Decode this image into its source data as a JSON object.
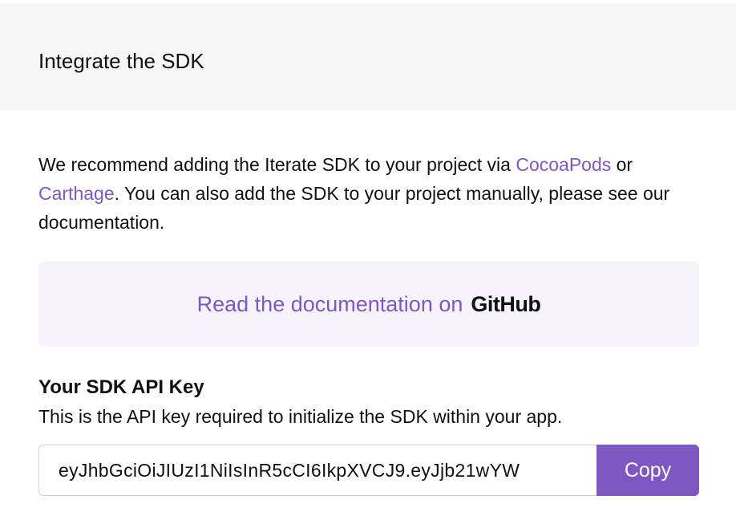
{
  "header": {
    "title": "Integrate the SDK"
  },
  "intro": {
    "text_before": "We recommend adding the Iterate SDK to your project via ",
    "cocoapods_link": "CocoaPods",
    "text_or": " or ",
    "carthage_link": "Carthage",
    "text_after": ". You can also add the SDK to your project manually, please see our documentation."
  },
  "docs": {
    "label": "Read the documentation on",
    "brand": "GitHub"
  },
  "api_key": {
    "title": "Your SDK API Key",
    "description": "This is the API key required to initialize the SDK within your app.",
    "value": "eyJhbGciOiJIUzI1NiIsInR5cCI6IkpXVCJ9.eyJjb21wYW",
    "copy_label": "Copy"
  },
  "colors": {
    "accent": "#7f57c2",
    "header_bg": "#f6f6f6",
    "docs_bg": "#f6f3fb"
  }
}
